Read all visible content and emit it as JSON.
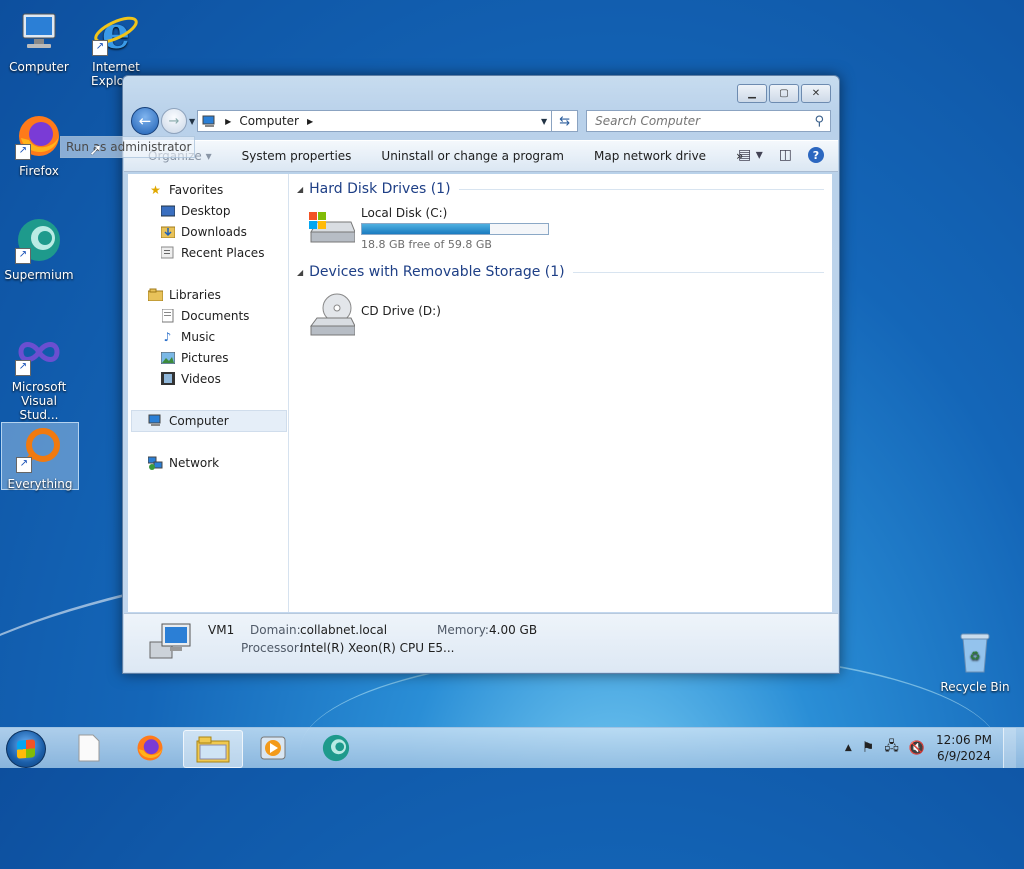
{
  "desktop": {
    "icons": [
      {
        "label": "Computer"
      },
      {
        "label": "Internet Explorer"
      },
      {
        "label": "Firefox"
      },
      {
        "label": "Supermium"
      },
      {
        "label": "Microsoft Visual Stud..."
      },
      {
        "label": "Everything"
      },
      {
        "label": "Recycle Bin"
      }
    ],
    "tooltip": "Run as administrator"
  },
  "window": {
    "address": {
      "location": "Computer"
    },
    "search": {
      "placeholder": "Search Computer"
    },
    "toolbar": {
      "organize": "Organize ▾",
      "system_properties": "System properties",
      "uninstall": "Uninstall or change a program",
      "map_network": "Map network drive",
      "more": "»"
    },
    "nav": {
      "favorites": "Favorites",
      "desktop": "Desktop",
      "downloads": "Downloads",
      "recent": "Recent Places",
      "libraries": "Libraries",
      "documents": "Documents",
      "music": "Music",
      "pictures": "Pictures",
      "videos": "Videos",
      "computer": "Computer",
      "network": "Network"
    },
    "groups": {
      "hdd": "Hard Disk Drives (1)",
      "removable": "Devices with Removable Storage (1)"
    },
    "drives": {
      "c": {
        "name": "Local Disk (C:)",
        "free_text": "18.8 GB free of 59.8 GB",
        "used_fraction": 0.686
      },
      "d": {
        "name": "CD Drive (D:)"
      }
    },
    "details": {
      "name": "VM1",
      "domain_label": "Domain:",
      "domain": "collabnet.local",
      "memory_label": "Memory:",
      "memory": "4.00 GB",
      "processor_label": "Processor:",
      "processor": "Intel(R) Xeon(R) CPU E5..."
    }
  },
  "taskbar": {
    "clock_time": "12:06 PM",
    "clock_date": "6/9/2024"
  },
  "colors": {
    "accent": "#1e3f86",
    "drive_bar": "#1a7bc0"
  }
}
